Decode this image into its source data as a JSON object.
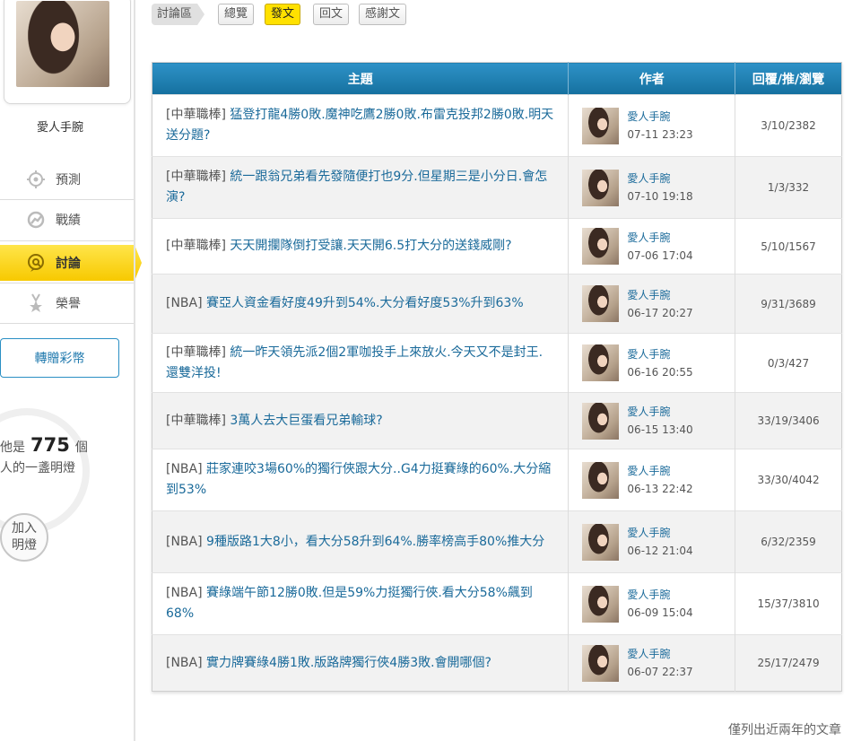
{
  "profile": {
    "username": "愛人手腕"
  },
  "sidebar": {
    "items": [
      {
        "label": "預測",
        "icon": "target-icon",
        "active": false
      },
      {
        "label": "戰績",
        "icon": "trend-icon",
        "active": false
      },
      {
        "label": "討論",
        "icon": "chat-icon",
        "active": true
      },
      {
        "label": "榮譽",
        "icon": "medal-icon",
        "active": false
      }
    ],
    "gift_button": "轉贈彩幣",
    "lamp_prefix": "他是",
    "lamp_count": "775",
    "lamp_suffix": "個",
    "lamp_line2": "人的一盞明燈",
    "lamp_button_line1": "加入",
    "lamp_button_line2": "明燈"
  },
  "tabs": {
    "section": "討論區",
    "items": [
      {
        "label": "總覽",
        "active": false
      },
      {
        "label": "發文",
        "active": true
      },
      {
        "label": "回文",
        "active": false
      },
      {
        "label": "感謝文",
        "active": false
      }
    ]
  },
  "table": {
    "headers": {
      "topic": "主題",
      "author": "作者",
      "stats": "回覆/推/瀏覽"
    },
    "rows": [
      {
        "tag": "[中華職棒]",
        "title": "猛登打龍4勝0敗.魔神吃鷹2勝0敗.布雷克投邦2勝0敗.明天送分題?",
        "author": "愛人手腕",
        "time": "07-11 23:23",
        "stats": "3/10/2382"
      },
      {
        "tag": "[中華職棒]",
        "title": "統一跟翁兄弟看先發隨便打也9分.但星期三是小分日.會怎演?",
        "author": "愛人手腕",
        "time": "07-10 19:18",
        "stats": "1/3/332"
      },
      {
        "tag": "[中華職棒]",
        "title": "天天開攔隊倒打受讓.天天開6.5打大分的送錢威剛?",
        "author": "愛人手腕",
        "time": "07-06 17:04",
        "stats": "5/10/1567"
      },
      {
        "tag": "[NBA]",
        "title": "賽亞人資金看好度49升到54%.大分看好度53%升到63%",
        "author": "愛人手腕",
        "time": "06-17 20:27",
        "stats": "9/31/3689"
      },
      {
        "tag": "[中華職棒]",
        "title": "統一昨天領先派2個2軍咖投手上來放火.今天又不是封王.還雙洋投!",
        "author": "愛人手腕",
        "time": "06-16 20:55",
        "stats": "0/3/427"
      },
      {
        "tag": "[中華職棒]",
        "title": "3萬人去大巨蛋看兄弟輸球?",
        "author": "愛人手腕",
        "time": "06-15 13:40",
        "stats": "33/19/3406"
      },
      {
        "tag": "[NBA]",
        "title": "莊家連咬3場60%的獨行俠跟大分..G4力挺賽綠的60%.大分縮到53%",
        "author": "愛人手腕",
        "time": "06-13 22:42",
        "stats": "33/30/4042"
      },
      {
        "tag": "[NBA]",
        "title": "9種版路1大8小，看大分58升到64%.勝率榜高手80%推大分",
        "author": "愛人手腕",
        "time": "06-12 21:04",
        "stats": "6/32/2359"
      },
      {
        "tag": "[NBA]",
        "title": "賽綠端午節12勝0敗.但是59%力挺獨行俠.看大分58%飆到68%",
        "author": "愛人手腕",
        "time": "06-09 15:04",
        "stats": "15/37/3810"
      },
      {
        "tag": "[NBA]",
        "title": "實力牌賽綠4勝1敗.版路牌獨行俠4勝3敗.會開哪個?",
        "author": "愛人手腕",
        "time": "06-07 22:37",
        "stats": "25/17/2479"
      }
    ]
  },
  "footer": {
    "note": "僅列出近兩年的文章"
  },
  "colors": {
    "accent_yellow": "#ffe100",
    "header_blue": "#1f7fb3",
    "link_blue": "#1a6a9a"
  }
}
